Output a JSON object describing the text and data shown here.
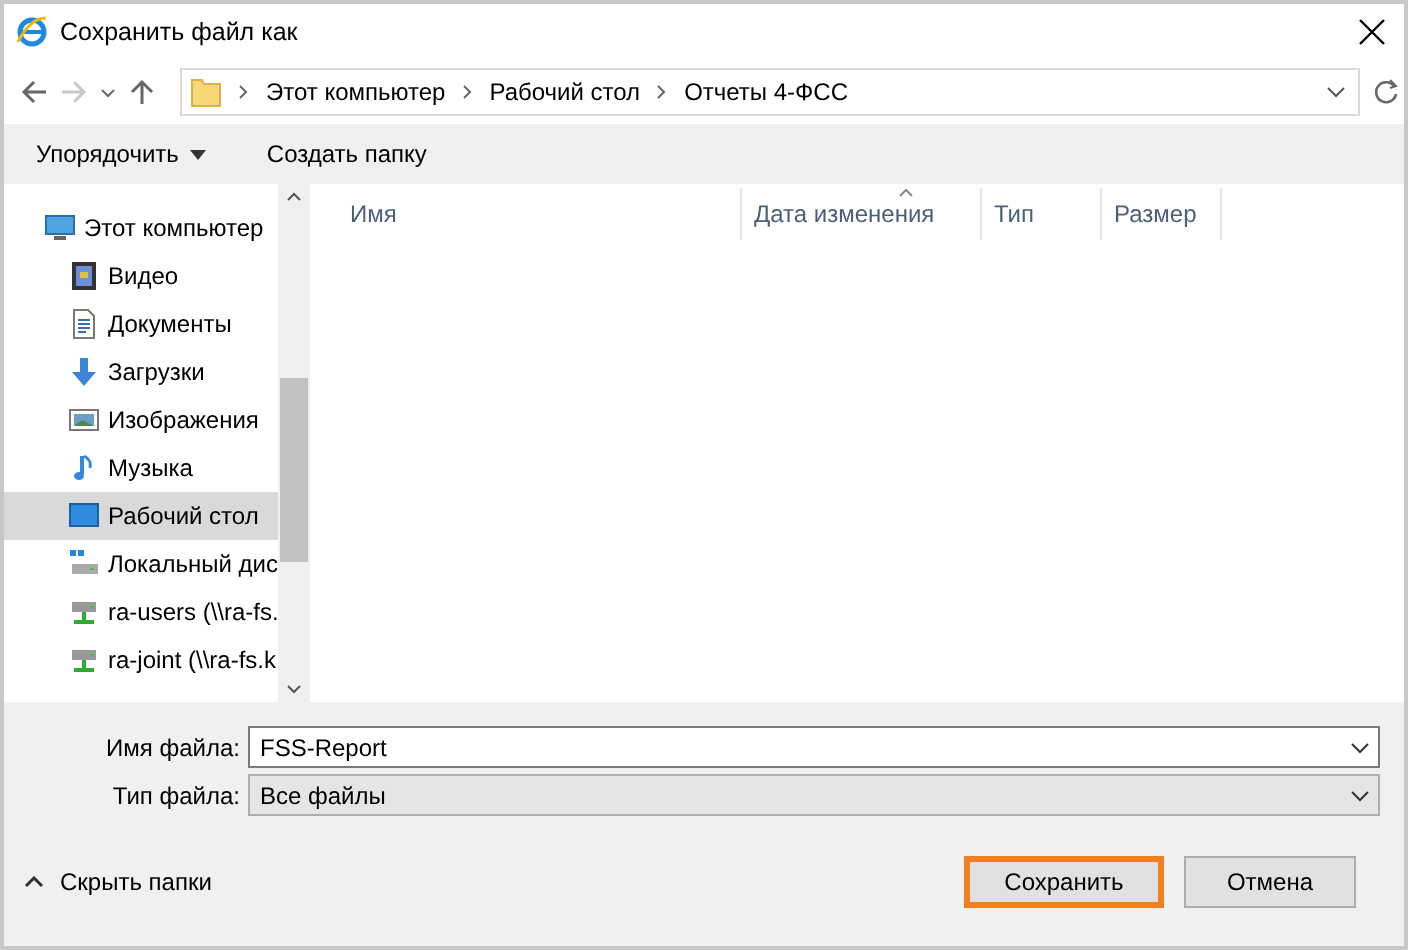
{
  "window": {
    "title": "Сохранить файл как"
  },
  "address_bar": {
    "path": [
      "Этот компьютер",
      "Рабочий стол",
      "Отчеты 4-ФСС"
    ]
  },
  "toolbar": {
    "organize": "Упорядочить",
    "new_folder": "Создать папку"
  },
  "sidebar": {
    "items": [
      {
        "label": "Этот компьютер",
        "kind": "computer",
        "selected": false,
        "children": [
          {
            "label": "Видео",
            "kind": "video",
            "selected": false
          },
          {
            "label": "Документы",
            "kind": "documents",
            "selected": false
          },
          {
            "label": "Загрузки",
            "kind": "downloads",
            "selected": false
          },
          {
            "label": "Изображения",
            "kind": "pictures",
            "selected": false
          },
          {
            "label": "Музыка",
            "kind": "music",
            "selected": false
          },
          {
            "label": "Рабочий стол",
            "kind": "desktop",
            "selected": true
          },
          {
            "label": "Локальный дис",
            "kind": "disk",
            "selected": false
          },
          {
            "label": "ra-users (\\\\ra-fs.",
            "kind": "network",
            "selected": false
          },
          {
            "label": "ra-joint (\\\\ra-fs.k",
            "kind": "network",
            "selected": false
          }
        ]
      }
    ]
  },
  "file_list": {
    "columns": [
      "Имя",
      "Дата изменения",
      "Тип",
      "Размер"
    ]
  },
  "form": {
    "file_name_label": "Имя файла:",
    "file_name": "FSS-Report",
    "file_type_label": "Тип файла:",
    "file_type": "Все файлы"
  },
  "footer": {
    "hide_folders": "Скрыть папки",
    "buttons": [
      {
        "label": "Сохранить",
        "selected": true
      },
      {
        "label": "Отмена",
        "selected": false
      }
    ]
  }
}
